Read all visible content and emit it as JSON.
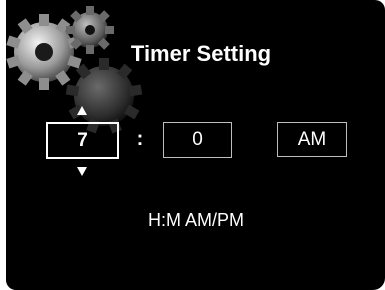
{
  "screen": {
    "title": "Timer Setting",
    "background_color": "#000000",
    "decoration_icon": "gears-icon"
  },
  "time": {
    "hour": "7",
    "separator": ":",
    "minute": "0",
    "meridiem": "AM"
  },
  "format_hint": "H:M AM/PM"
}
